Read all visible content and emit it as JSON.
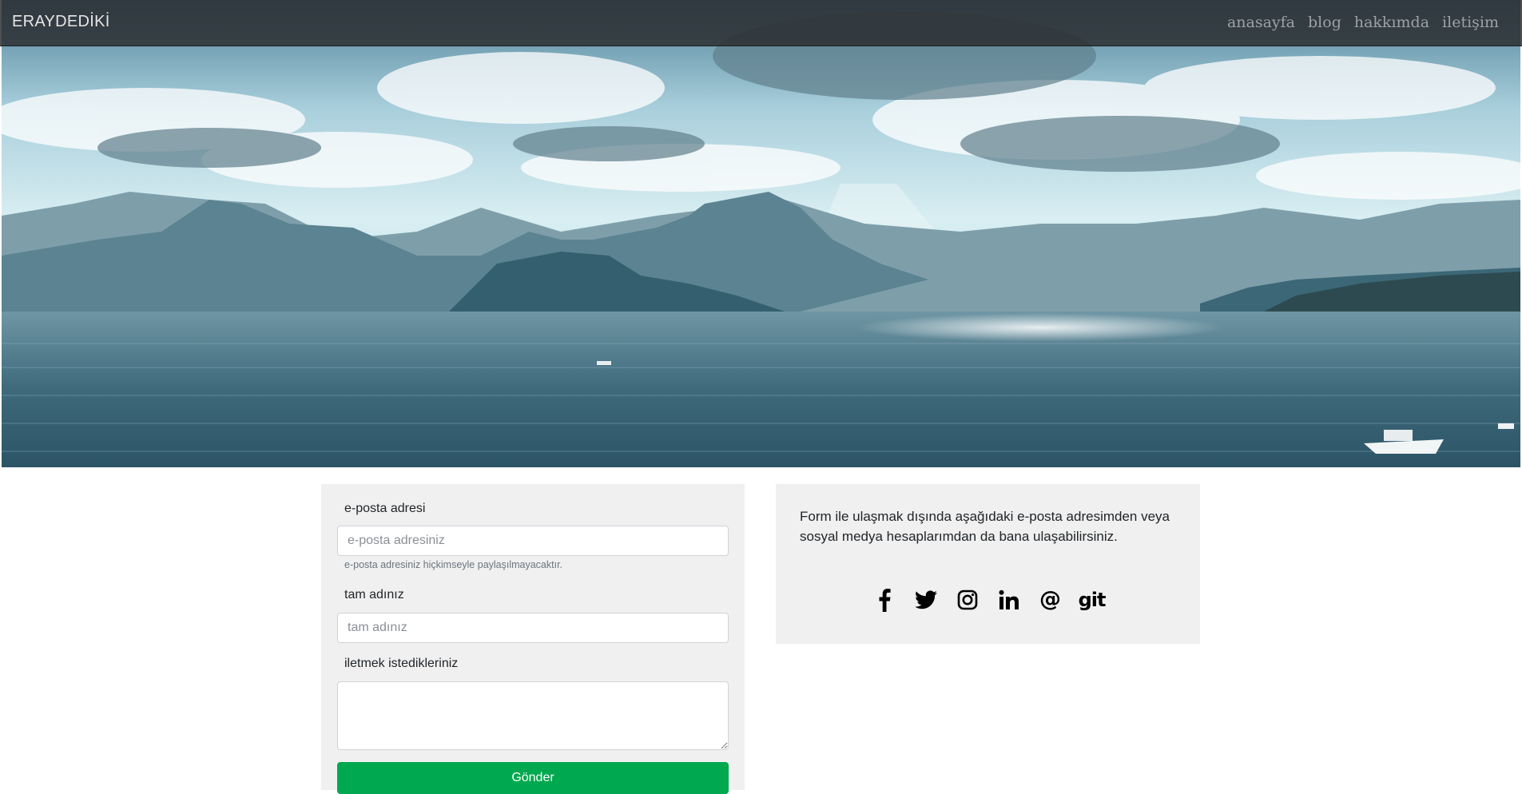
{
  "navbar": {
    "brand": "ERAYDEDİKİ",
    "links": [
      "anasayfa",
      "blog",
      "hakkımda",
      "iletişim"
    ]
  },
  "form": {
    "email_label": "e-posta adresi",
    "email_placeholder": "e-posta adresiniz",
    "email_help": "e-posta adresiniz hiçkimseyle paylaşılmayacaktır.",
    "name_label": "tam adınız",
    "name_placeholder": "tam adınız",
    "message_label": "iletmek istedikleriniz",
    "message_value": "",
    "submit_label": "Gönder"
  },
  "info": {
    "text": "Form ile ulaşmak dışında aşağıdaki e-posta adresimden veya sosyal medya hesaplarımdan da bana ulaşabilirsiniz.",
    "socials": [
      {
        "icon": "facebook-icon"
      },
      {
        "icon": "twitter-icon"
      },
      {
        "icon": "instagram-icon"
      },
      {
        "icon": "linkedin-icon"
      },
      {
        "icon": "at-icon",
        "glyph": "@"
      },
      {
        "icon": "git-icon",
        "glyph": "git"
      }
    ]
  },
  "colors": {
    "navbar_bg": "#2b2d2f",
    "submit_bg": "#00a84f",
    "card_bg": "#f0f0f0"
  }
}
